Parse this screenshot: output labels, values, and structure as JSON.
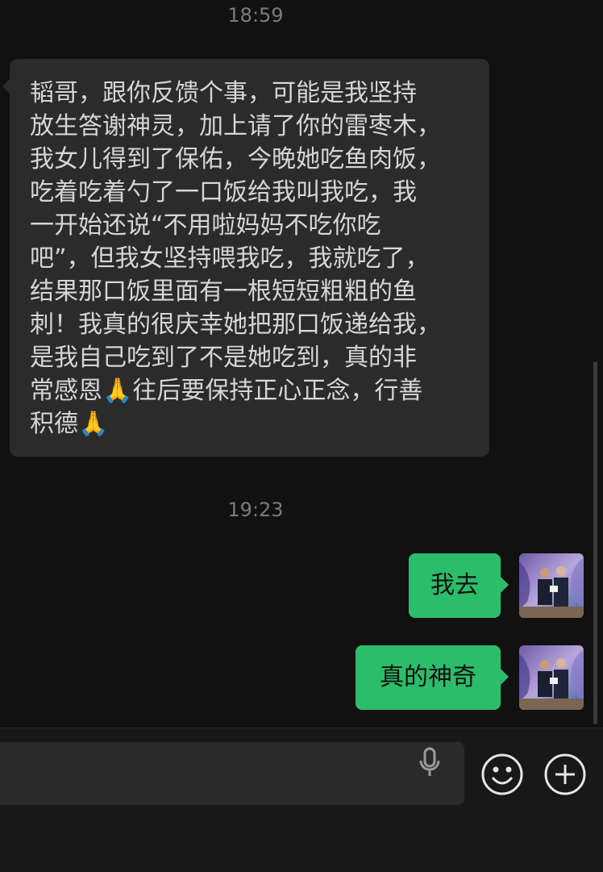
{
  "timestamps": [
    "18:59",
    "19:23"
  ],
  "incoming_message": {
    "lines": [
      "韬哥，跟你反馈个事，可能是我坚持",
      "放生答谢神灵，加上请了你的雷枣木，",
      "我女儿得到了保佑，今晚她吃鱼肉饭，",
      "吃着吃着勺了一口饭给我叫我吃，我",
      "一开始还说“不用啦妈妈不吃你吃",
      "吧”，但我女坚持喂我吃，我就吃了，",
      "结果那口饭里面有一根短短粗粗的鱼",
      "刺！我真的很庆幸她把那口饭递给我，",
      "是我自己吃到了不是她吃到，真的非",
      "常感恩🙏往后要保持正心正念，行善",
      "积德🙏"
    ]
  },
  "outgoing_messages": [
    {
      "text": "我去"
    },
    {
      "text": "真的神奇"
    }
  ],
  "input_bar": {
    "input_value": "",
    "icons": [
      "mic-icon",
      "emoji-icon",
      "plus-icon"
    ]
  },
  "colors": {
    "background": "#111111",
    "incoming_bubble": "#2b2b2b",
    "outgoing_bubble": "#2bbd6a",
    "timestamp": "#7b7b7b"
  }
}
